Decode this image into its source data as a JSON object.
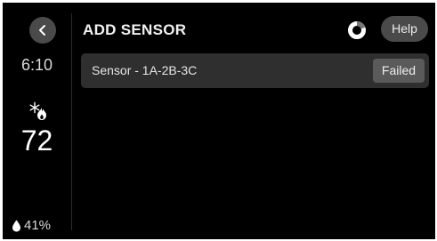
{
  "sidebar": {
    "back_icon": "chevron-left-icon",
    "time": "6:10",
    "mode_icon": "heat-cool-icon",
    "temperature": "72",
    "humidity_icon": "water-drop-icon",
    "humidity": "41%"
  },
  "header": {
    "title": "ADD SENSOR",
    "status_icon": "progress-ring-icon",
    "help_label": "Help"
  },
  "sensors": [
    {
      "name": "Sensor - 1A-2B-3C",
      "status": "Failed"
    }
  ],
  "colors": {
    "background": "#000000",
    "button": "#4a4a4a",
    "row": "#2f2f2f",
    "badge": "#5a5a5a",
    "text": "#e8e8e8"
  }
}
